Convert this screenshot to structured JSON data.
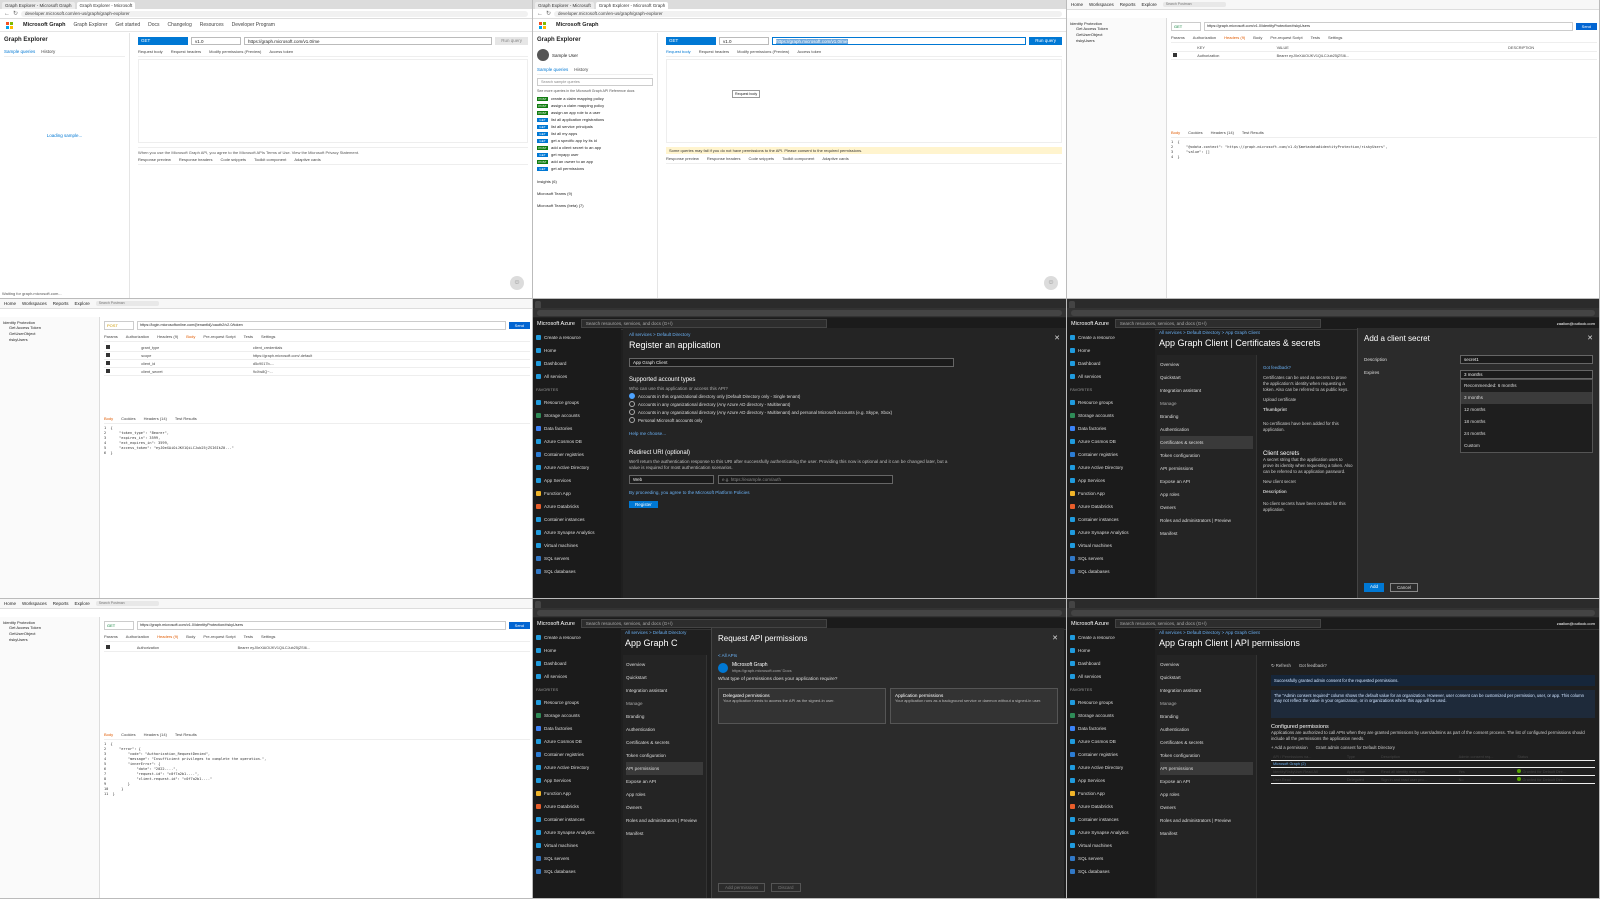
{
  "cells": {
    "c1": {
      "tabs": [
        "Graph Explorer - Microsoft Graph",
        "Graph Explorer - Microsoft"
      ],
      "url": "developer.microsoft.com/en-us/graph/graph-explorer",
      "brand": "Microsoft Graph",
      "nav": [
        "Microsoft",
        "Graph Explorer",
        "Get started",
        "Docs",
        "Changelog",
        "Resources",
        "Developer Program"
      ],
      "title": "Graph Explorer",
      "side_tabs": [
        "Sample queries",
        "History"
      ],
      "loading": "Loading sample...",
      "method": "GET",
      "version": "v1.0",
      "query": "https://graph.microsoft.com/v1.0/me",
      "run": "Run query",
      "subtabs": [
        "Request body",
        "Request headers",
        "Modify permissions (Preview)",
        "Access token"
      ],
      "notice": "When you use the Microsoft Graph API, you agree to the Microsoft APIs Terms of Use. View the Microsoft Privacy Statement.",
      "resp_tabs": [
        "Response preview",
        "Response headers",
        "Code snippets",
        "Toolkit component",
        "Adaptive cards"
      ],
      "status": "Waiting for graph.microsoft.com..."
    },
    "c2": {
      "tabs": [
        "Graph Explorer - Microsoft",
        "Graph Explorer - Microsoft Graph"
      ],
      "url": "developer.microsoft.com/en-us/graph/graph-explorer",
      "brand": "Microsoft Graph",
      "title": "Graph Explorer",
      "user": "Sample User",
      "side_tabs": [
        "Sample queries",
        "History"
      ],
      "search": "Search sample queries",
      "hint": "See more queries in the Microsoft Graph API Reference docs",
      "samples": [
        {
          "m": "POST",
          "t": "create a claim mapping policy"
        },
        {
          "m": "POST",
          "t": "assign a claim mapping policy"
        },
        {
          "m": "POST",
          "t": "assign an app role to a user"
        },
        {
          "m": "GET",
          "t": "list all application registrations"
        },
        {
          "m": "GET",
          "t": "list all service principals"
        },
        {
          "m": "GET",
          "t": "list all my apps"
        },
        {
          "m": "GET",
          "t": "get a specific app by its id"
        },
        {
          "m": "POST",
          "t": "add a client secret to an app"
        },
        {
          "m": "GET",
          "t": "get myapp user"
        },
        {
          "m": "POST",
          "t": "add an owner to an app"
        },
        {
          "m": "GET",
          "t": "get all permissions"
        }
      ],
      "groups": [
        "Insights (6)",
        "Microsoft Teams (9)",
        "Microsoft Teams (beta) (7)"
      ],
      "method": "GET",
      "version": "v1.0",
      "query": "https://graph.microsoft.com/v1.0/me",
      "run": "Run query",
      "subtabs": [
        "Request body",
        "Request headers",
        "Modify permissions (Preview)",
        "Access token"
      ],
      "tooltip": "Request body",
      "warn": "Some queries may fail if you do not have permissions to the API. Please consent to the required permissions.",
      "resp_tabs": [
        "Response preview",
        "Response headers",
        "Code snippets",
        "Toolkit component",
        "Adaptive cards"
      ]
    },
    "c3": {
      "menu": [
        "Home",
        "Workspaces",
        "Reports",
        "Explore"
      ],
      "search": "Search Postman",
      "collection": "Identity Protection",
      "items": [
        "Get Access Token",
        "GetUserObject",
        "riskyUsers"
      ],
      "method": "GET",
      "url": "https://graph.microsoft.com/v1.0/identityProtection/riskyUsers",
      "send": "Send",
      "params": [
        "Params",
        "Authorization",
        "Headers (9)",
        "Body",
        "Pre-request Script",
        "Tests",
        "Settings"
      ],
      "table_head": [
        "KEY",
        "VALUE",
        "DESCRIPTION"
      ],
      "row1": [
        "Authorization",
        "Bearer eyJ0eXAiOiJKV1QiLCJub25jZSI6..."
      ],
      "resp_tabs": [
        "Body",
        "Cookies",
        "Headers (14)",
        "Test Results"
      ],
      "code": [
        "{",
        "    \"@odata.context\": \"https://graph.microsoft.com/v1.0/$metadata#identityProtection/riskyUsers\",",
        "    \"value\": []",
        "}"
      ]
    },
    "c4": {
      "menu": [
        "Home",
        "Workspaces",
        "Reports",
        "Explore"
      ],
      "search": "Search Postman",
      "collection": "Identity Protection",
      "items": [
        "Get Access Token",
        "GetUserObject",
        "riskyUsers"
      ],
      "method": "POST",
      "url": "https://login.microsoftonline.com/{tenantId}/oauth2/v2.0/token",
      "send": "Send",
      "params": [
        "Params",
        "Authorization",
        "Headers (9)",
        "Body",
        "Pre-request Script",
        "Tests",
        "Settings"
      ],
      "rows": [
        [
          "grant_type",
          "client_credentials"
        ],
        [
          "scope",
          "https://graph.microsoft.com/.default"
        ],
        [
          "client_id",
          "d5c9017b-..."
        ],
        [
          "client_secret",
          "9cXw8Q~..."
        ]
      ],
      "resp_tabs": [
        "Body",
        "Cookies",
        "Headers (14)",
        "Test Results"
      ],
      "code": [
        "{",
        "    \"token_type\": \"Bearer\",",
        "    \"expires_in\": 3599,",
        "    \"ext_expires_in\": 3599,",
        "    \"access_token\": \"eyJ0eXAiOiJKV1QiLCJub25jZSI6IkZ0...\"",
        "}"
      ]
    },
    "c5": {
      "brand": "Microsoft Azure",
      "search": "Search resources, services, and docs (G+/)",
      "nav": [
        "Create a resource",
        "Home",
        "Dashboard",
        "All services",
        "FAVORITES",
        "Resource groups",
        "Storage accounts",
        "Data factories",
        "Azure Cosmos DB",
        "Container registries",
        "Azure Active Directory",
        "App Services",
        "Function App",
        "Azure Databricks",
        "Container instances",
        "Azure Synapse Analytics",
        "Virtual machines",
        "SQL servers",
        "SQL databases"
      ],
      "bread": "All services  >  Default Directory",
      "title": "Register an application",
      "name_value": "App Graph Client",
      "acct_h": "Supported account types",
      "acct_q": "Who can use this application or access this API?",
      "options": [
        "Accounts in this organizational directory only (Default Directory only - Single tenant)",
        "Accounts in any organizational directory (Any Azure AD directory - Multitenant)",
        "Accounts in any organizational directory (Any Azure AD directory - Multitenant) and personal Microsoft accounts (e.g. Skype, Xbox)",
        "Personal Microsoft accounts only"
      ],
      "help": "Help me choose...",
      "redirect_h": "Redirect URI (optional)",
      "redirect_p": "We'll return the authentication response to this URI after successfully authenticating the user. Providing this now is optional and it can be changed later, but a value is required for most authentication scenarios.",
      "platform": "Web",
      "placeholder": "e.g. https://example.com/auth",
      "policy": "By proceeding, you agree to the Microsoft Platform Policies",
      "register": "Register"
    },
    "c6": {
      "brand": "Microsoft Azure",
      "search": "Search resources, services, and docs (G+/)",
      "account": "zaalion@outlook.com",
      "tenant": "DEFAULT DIRECTORY (ZAALION...",
      "bread": "All services  >  Default Directory  >  App Graph Client",
      "title": "App Graph Client | Certificates & secrets",
      "menu": [
        "Overview",
        "Quickstart",
        "Integration assistant",
        "Manage",
        "Branding",
        "Authentication",
        "Certificates & secrets",
        "Token configuration",
        "API permissions",
        "Expose an API",
        "App roles",
        "Owners",
        "Roles and administrators | Preview",
        "Manifest"
      ],
      "feedback": "Got feedback?",
      "cert_p": "Certificates can be used as secrets to prove the application's identity when requesting a token. Also can be referred to as public keys.",
      "upload": "Upload certificate",
      "thumb": "Thumbprint",
      "no_cert": "No certificates have been added for this application.",
      "secrets_h": "Client secrets",
      "secrets_p": "A secret string that the application uses to prove its identity when requesting a token. Also can be referred to as application password.",
      "new_secret": "New client secret",
      "desc_col": "Description",
      "no_secret": "No client secrets have been created for this application.",
      "modal_title": "Add a client secret",
      "desc_label": "Description",
      "desc_value": "secret1",
      "exp_label": "Expires",
      "exp_value": "3 months",
      "options": [
        "Recommended: 6 months",
        "3 months",
        "12 months",
        "18 months",
        "24 months",
        "Custom"
      ],
      "add": "Add",
      "cancel": "Cancel"
    },
    "c7": {
      "menu": [
        "Home",
        "Workspaces",
        "Reports",
        "Explore"
      ],
      "search": "Search Postman",
      "collection": "Identity Protection",
      "items": [
        "Get Access Token",
        "GetUserObject",
        "riskyUsers"
      ],
      "method": "GET",
      "url": "https://graph.microsoft.com/v1.0/identityProtection/riskyUsers",
      "send": "Send",
      "params": [
        "Params",
        "Authorization",
        "Headers (9)",
        "Body",
        "Pre-request Script",
        "Tests",
        "Settings"
      ],
      "row1": [
        "Authorization",
        "Bearer eyJ0eXAiOiJKV1QiLCJub25jZSI6..."
      ],
      "resp_tabs": [
        "Body",
        "Cookies",
        "Headers (14)",
        "Test Results"
      ],
      "code": [
        "{",
        "    \"error\": {",
        "        \"code\": \"Authorization_RequestDenied\",",
        "        \"message\": \"Insufficient privileges to complete the operation.\",",
        "        \"innerError\": {",
        "            \"date\": \"2022-...\",",
        "            \"request-id\": \"c0f7a2b1-...\",",
        "            \"client-request-id\": \"c0f7a2b1-...\"",
        "        }",
        "    }",
        "}"
      ]
    },
    "c8": {
      "brand": "Microsoft Azure",
      "search": "Search resources, services, and docs (G+/)",
      "bread": "All services  >  Default Directory",
      "app_title": "App Graph C",
      "title": "Request API permissions",
      "all_apis": "< All APIs",
      "api_name": "Microsoft Graph",
      "api_url": "https://graph.microsoft.com/  Docs",
      "question": "What type of permissions does your application require?",
      "delegated_h": "Delegated permissions",
      "delegated_p": "Your application needs to access the API as the signed-in user.",
      "application_h": "Application permissions",
      "application_p": "Your application runs as a background service or daemon without a signed-in user.",
      "add_perm": "Add permissions",
      "discard": "Discard",
      "menu": [
        "Overview",
        "Quickstart",
        "Integration assistant",
        "Manage",
        "Branding",
        "Authentication",
        "Certificates & secrets",
        "Token configuration",
        "API permissions",
        "Expose an API",
        "App roles",
        "Owners",
        "Roles and administrators | Preview",
        "Manifest"
      ]
    },
    "c9": {
      "brand": "Microsoft Azure",
      "search": "Search resources, services, and docs (G+/)",
      "account": "zaalion@outlook.com",
      "bread": "All services  >  Default Directory  >  App Graph Client",
      "title": "App Graph Client | API permissions",
      "refresh": "Refresh",
      "feedback": "Got feedback?",
      "success": "Successfully granted admin consent for the requested permissions.",
      "info": "The \"Admin consent required\" column shows the default value for an organization. However, user consent can be customized per permission, user, or app. This column may not reflect the value in your organization, or in organizations where this app will be used.",
      "conf_h": "Configured permissions",
      "conf_p": "Applications are authorized to call APIs when they are granted permissions by users/admins as part of the consent process. The list of configured permissions should include all the permissions the application needs.",
      "add_perm": "+ Add a permission",
      "grant": "Grant admin consent for Default Directory",
      "cols": [
        "API / Permissions na...",
        "Type",
        "Description",
        "Admin consent req...",
        "Status"
      ],
      "group": "Microsoft Graph (2)",
      "rows": [
        [
          "IdentityRiskyUser.Read.All",
          "Application",
          "Read all identity risky user...",
          "Yes",
          "Granted for Default Dire..."
        ],
        [
          "User.Read",
          "Delegated",
          "Sign in and read user pro...",
          "No",
          "Granted for Default Dire..."
        ]
      ],
      "menu": [
        "Overview",
        "Quickstart",
        "Integration assistant",
        "Manage",
        "Branding",
        "Authentication",
        "Certificates & secrets",
        "Token configuration",
        "API permissions",
        "Expose an API",
        "App roles",
        "Owners",
        "Roles and administrators | Preview",
        "Manifest"
      ]
    }
  },
  "colors": {
    "azure_blue": "#0078d4",
    "postman_blue": "#0265d2",
    "graph_post": "#107c10",
    "success_green": "#57a300"
  }
}
